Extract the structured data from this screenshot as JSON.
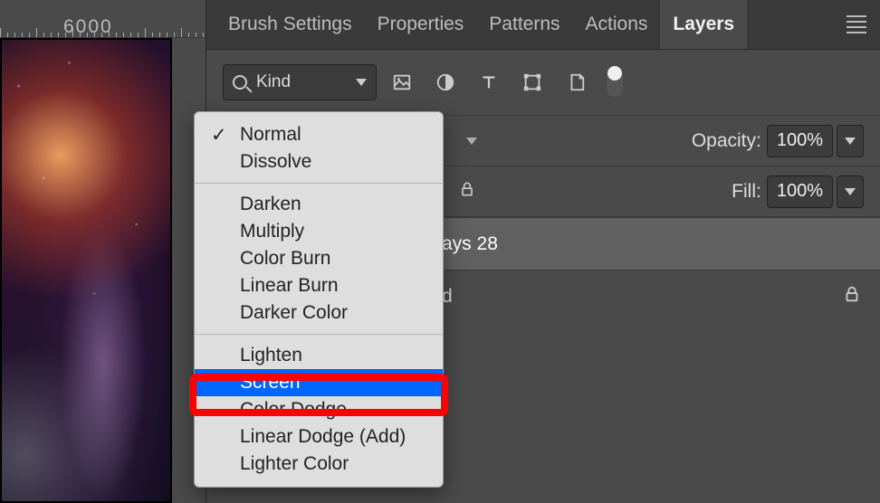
{
  "tabs": {
    "brush": "Brush Settings",
    "properties": "Properties",
    "patterns": "Patterns",
    "actions": "Actions",
    "layers": "Layers"
  },
  "ruler": {
    "label": "6000"
  },
  "filter": {
    "kind": "Kind"
  },
  "opacity": {
    "label": "Opacity:",
    "value": "100%"
  },
  "fill": {
    "label": "Fill:",
    "value": "100%"
  },
  "layers_list": {
    "item1_suffix": "ays 28",
    "item2_suffix": "d"
  },
  "blend_menu": {
    "g1": {
      "normal": "Normal",
      "dissolve": "Dissolve"
    },
    "g2": {
      "darken": "Darken",
      "multiply": "Multiply",
      "color_burn": "Color Burn",
      "linear_burn": "Linear Burn",
      "darker_color": "Darker Color"
    },
    "g3": {
      "lighten": "Lighten",
      "screen": "Screen",
      "color_dodge": "Color Dodge",
      "linear_dodge": "Linear Dodge (Add)",
      "lighter_color": "Lighter Color"
    }
  }
}
